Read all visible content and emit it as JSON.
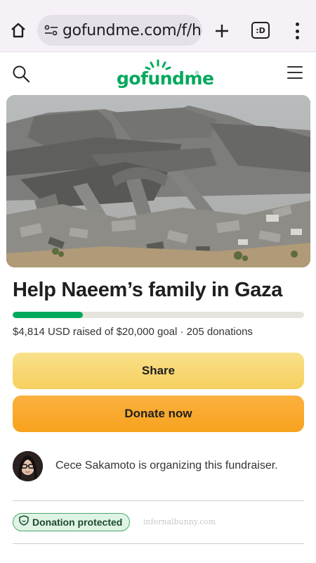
{
  "browser": {
    "url_text": "gofundme.com/f/help-naeems-family-in-gaza",
    "tabs_label": ":D"
  },
  "site": {
    "logo_text": "gofundme",
    "brand_color": "#02a95c"
  },
  "campaign": {
    "title": "Help Naeem’s family in Gaza",
    "progress_fraction": 0.2407,
    "raised_text": "$4,814 USD raised of $20,000 goal · 205 donations",
    "share_label": "Share",
    "donate_label": "Donate now",
    "organizer_text": "Cece Sakamoto is organizing this fundraiser.",
    "protected_label": "Donation protected",
    "watermark": "infernalbunny.com"
  },
  "icons": {
    "home": "home-icon",
    "site_info": "tune-icon",
    "new_tab": "plus-icon",
    "tabs": "tab-switcher-icon",
    "overflow": "more-vert-icon",
    "search": "search-icon",
    "menu": "hamburger-menu-icon",
    "shield": "shield-icon"
  }
}
